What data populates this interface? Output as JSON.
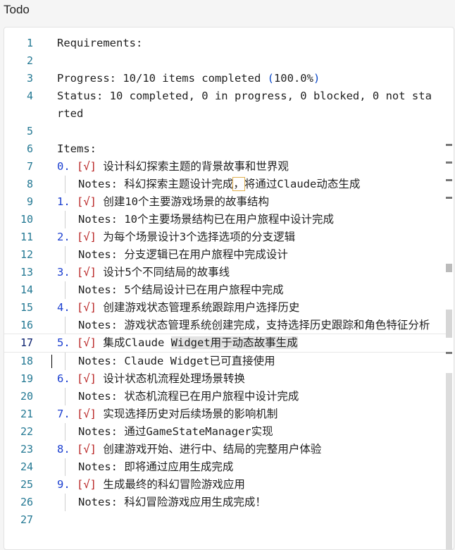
{
  "window": {
    "title": "Todo"
  },
  "lines": [
    {
      "n": "1",
      "parts": [
        {
          "t": "Requirements:"
        }
      ]
    },
    {
      "n": "2",
      "parts": []
    },
    {
      "n": "3",
      "parts": [
        {
          "t": "Progress: 10/10 items completed "
        },
        {
          "t": "(",
          "c": "br"
        },
        {
          "t": "100.0%"
        },
        {
          "t": ")",
          "c": "br"
        }
      ]
    },
    {
      "n": "4",
      "parts": [
        {
          "t": "Status: 10 completed, 0 in progress, 0 blocked, 0 not started"
        }
      ]
    },
    {
      "n": "5",
      "parts": []
    },
    {
      "n": "6",
      "parts": [
        {
          "t": "Items:"
        }
      ]
    },
    {
      "n": "7",
      "parts": [
        {
          "t": "0.",
          "c": "num"
        },
        {
          "t": " "
        },
        {
          "t": "[√]",
          "c": "chk"
        },
        {
          "t": " 设计科幻探索主题的背景故事和世界观"
        }
      ]
    },
    {
      "n": "8",
      "indent": true,
      "parts": [
        {
          "t": "Notes: 科幻探索主题设计完成"
        },
        {
          "t": "，",
          "c": "comma"
        },
        {
          "t": "将通过Claude动态生成"
        }
      ]
    },
    {
      "n": "9",
      "parts": [
        {
          "t": "1.",
          "c": "num"
        },
        {
          "t": " "
        },
        {
          "t": "[√]",
          "c": "chk"
        },
        {
          "t": " 创建10个主要游戏场景的故事结构"
        }
      ]
    },
    {
      "n": "10",
      "indent": true,
      "parts": [
        {
          "t": "Notes: 10个主要场景结构已在用户旅程中设计完成"
        }
      ]
    },
    {
      "n": "11",
      "parts": [
        {
          "t": "2.",
          "c": "num"
        },
        {
          "t": " "
        },
        {
          "t": "[√]",
          "c": "chk"
        },
        {
          "t": " 为每个场景设计3个选择选项的分支逻辑"
        }
      ]
    },
    {
      "n": "12",
      "indent": true,
      "parts": [
        {
          "t": "Notes: 分支逻辑已在用户旅程中完成设计"
        }
      ]
    },
    {
      "n": "13",
      "parts": [
        {
          "t": "3.",
          "c": "num"
        },
        {
          "t": " "
        },
        {
          "t": "[√]",
          "c": "chk"
        },
        {
          "t": " 设计5个不同结局的故事线"
        }
      ]
    },
    {
      "n": "14",
      "indent": true,
      "parts": [
        {
          "t": "Notes: 5个结局设计已在用户旅程中完成"
        }
      ]
    },
    {
      "n": "15",
      "parts": [
        {
          "t": "4.",
          "c": "num"
        },
        {
          "t": " "
        },
        {
          "t": "[√]",
          "c": "chk"
        },
        {
          "t": " 创建游戏状态管理系统跟踪用户选择历史"
        }
      ]
    },
    {
      "n": "16",
      "indent": true,
      "parts": [
        {
          "t": "Notes: 游戏状态管理系统创建完成，支持选择历史跟踪和角色特征分析"
        }
      ]
    },
    {
      "n": "17",
      "hl": true,
      "parts": [
        {
          "t": "5.",
          "c": "num"
        },
        {
          "t": " "
        },
        {
          "t": "[√]",
          "c": "chk"
        },
        {
          "t": " 集成Claude "
        },
        {
          "t": "Widget",
          "c": "sel"
        },
        {
          "t": "用于动态故事生成",
          "c": "sel"
        }
      ]
    },
    {
      "n": "18",
      "indent": true,
      "cursor": true,
      "parts": [
        {
          "t": "Notes: Claude Widget已可直接使用"
        }
      ]
    },
    {
      "n": "19",
      "parts": [
        {
          "t": "6.",
          "c": "num"
        },
        {
          "t": " "
        },
        {
          "t": "[√]",
          "c": "chk"
        },
        {
          "t": " 设计状态机流程处理场景转换"
        }
      ]
    },
    {
      "n": "20",
      "indent": true,
      "parts": [
        {
          "t": "Notes: 状态机流程已在用户旅程中设计完成"
        }
      ]
    },
    {
      "n": "21",
      "parts": [
        {
          "t": "7.",
          "c": "num"
        },
        {
          "t": " "
        },
        {
          "t": "[√]",
          "c": "chk"
        },
        {
          "t": " 实现选择历史对后续场景的影响机制"
        }
      ]
    },
    {
      "n": "22",
      "indent": true,
      "parts": [
        {
          "t": "Notes: 通过GameStateManager实现"
        }
      ]
    },
    {
      "n": "23",
      "parts": [
        {
          "t": "8.",
          "c": "num"
        },
        {
          "t": " "
        },
        {
          "t": "[√]",
          "c": "chk"
        },
        {
          "t": " 创建游戏开始、进行中、结局的完整用户体验"
        }
      ]
    },
    {
      "n": "24",
      "indent": true,
      "parts": [
        {
          "t": "Notes: 即将通过应用生成完成"
        }
      ]
    },
    {
      "n": "25",
      "parts": [
        {
          "t": "9.",
          "c": "num"
        },
        {
          "t": " "
        },
        {
          "t": "[√]",
          "c": "chk"
        },
        {
          "t": " 生成最终的科幻冒险游戏应用"
        }
      ]
    },
    {
      "n": "26",
      "indent": true,
      "parts": [
        {
          "t": "Notes: 科幻冒险游戏应用生成完成！"
        }
      ]
    },
    {
      "n": "27",
      "parts": []
    }
  ],
  "colors": {
    "line_number": "#237893",
    "list_number": "#1b3fd0",
    "checkmark": "#b82222",
    "bracket": "#0a48c8"
  }
}
